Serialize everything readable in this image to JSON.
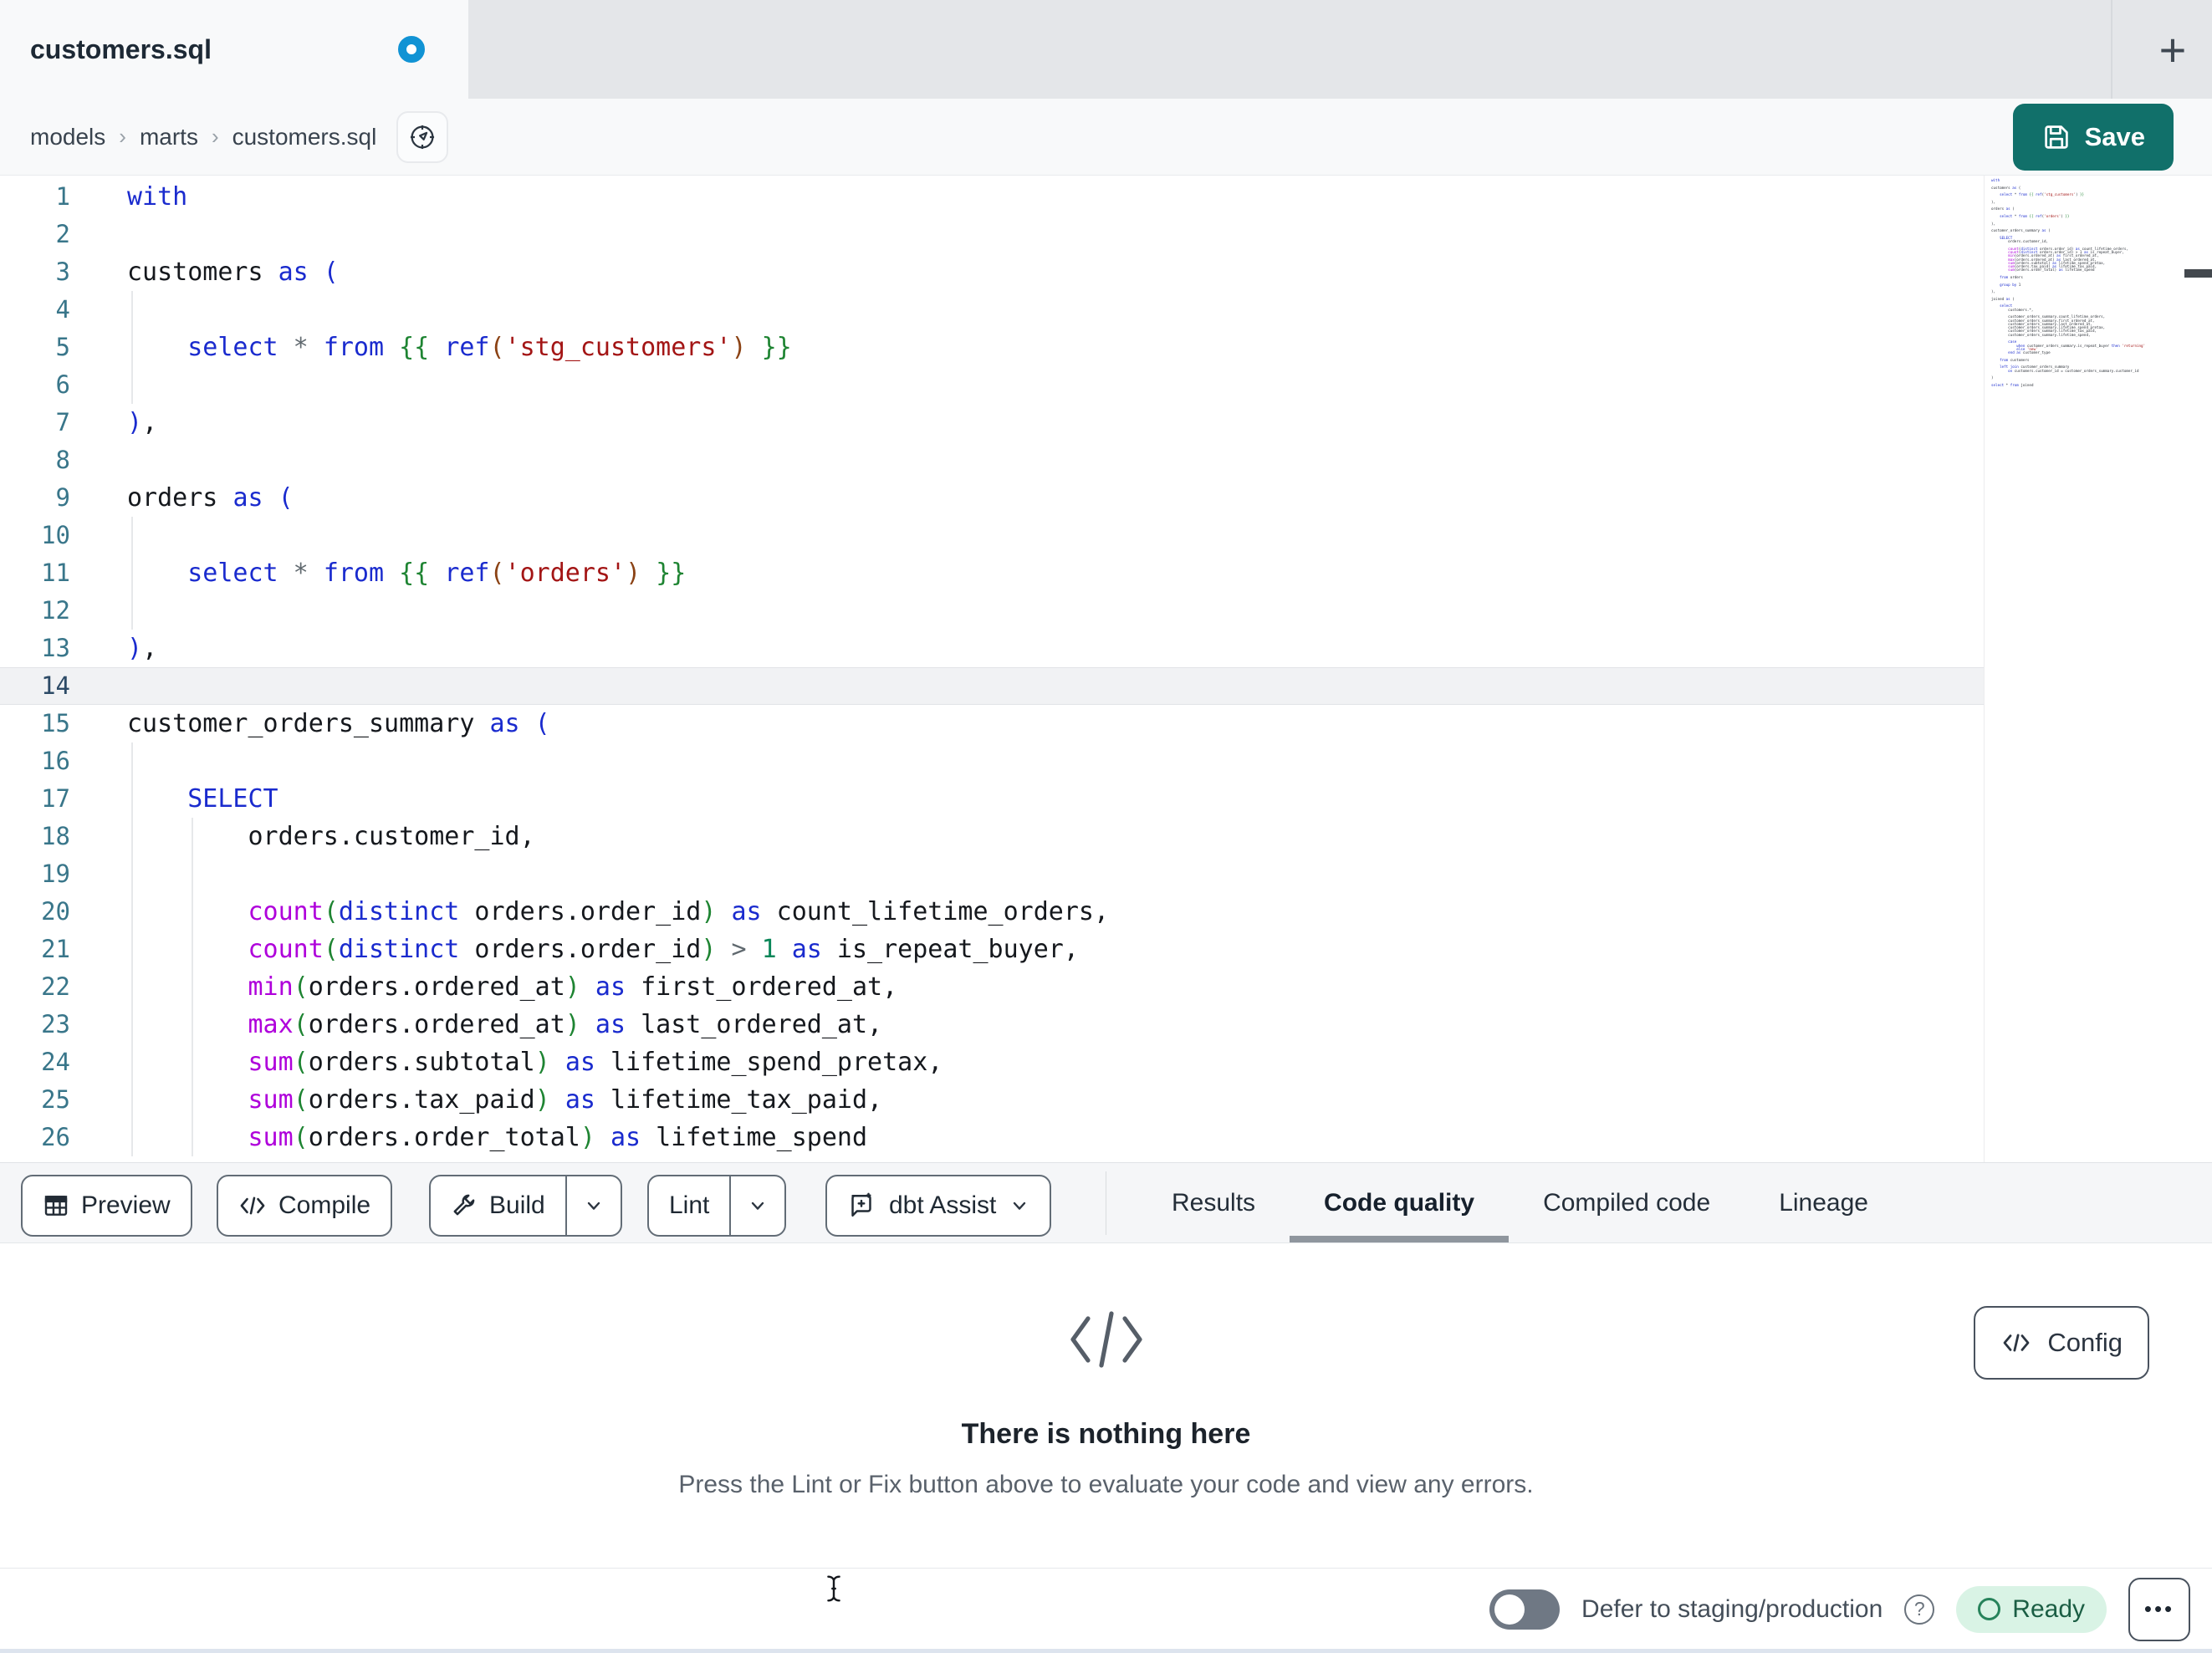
{
  "colors": {
    "accent_teal": "#11706a",
    "unsaved_dot_blue": "#1193d4",
    "ready_bg_green": "#d9f3e5",
    "ready_text_green": "#1b5e44",
    "keyword_blue": "#1a2bce",
    "string_red": "#a31515",
    "function_magenta": "#af00db"
  },
  "tab_strip": {
    "tab_title": "customers.sql",
    "new_tab_label": "+"
  },
  "breadcrumb": {
    "items": [
      "models",
      "marts",
      "customers.sql"
    ],
    "separator": "›"
  },
  "save": {
    "label": "Save"
  },
  "editor": {
    "active_line": 14,
    "lines": [
      {
        "n": 1,
        "g": 0,
        "tk": [
          [
            "k",
            "with"
          ]
        ]
      },
      {
        "n": 2,
        "g": 0,
        "tk": []
      },
      {
        "n": 3,
        "g": 0,
        "tk": [
          [
            "t",
            "customers "
          ],
          [
            "k",
            "as ("
          ]
        ]
      },
      {
        "n": 4,
        "g": 1,
        "tk": []
      },
      {
        "n": 5,
        "g": 1,
        "tk": [
          [
            "t",
            "    "
          ],
          [
            "k",
            "select"
          ],
          [
            "o",
            " * "
          ],
          [
            "k",
            "from"
          ],
          [
            "t",
            " "
          ],
          [
            "g",
            "{{"
          ],
          [
            "t",
            " "
          ],
          [
            "k",
            "ref"
          ],
          [
            "r",
            "("
          ],
          [
            "s",
            "'stg_customers'"
          ],
          [
            "r",
            ")"
          ],
          [
            "t",
            " "
          ],
          [
            "g",
            "}}"
          ]
        ]
      },
      {
        "n": 6,
        "g": 1,
        "tk": []
      },
      {
        "n": 7,
        "g": 0,
        "tk": [
          [
            "k",
            ")"
          ],
          [
            "t",
            ","
          ]
        ]
      },
      {
        "n": 8,
        "g": 0,
        "tk": []
      },
      {
        "n": 9,
        "g": 0,
        "tk": [
          [
            "t",
            "orders "
          ],
          [
            "k",
            "as ("
          ]
        ]
      },
      {
        "n": 10,
        "g": 1,
        "tk": []
      },
      {
        "n": 11,
        "g": 1,
        "tk": [
          [
            "t",
            "    "
          ],
          [
            "k",
            "select"
          ],
          [
            "o",
            " * "
          ],
          [
            "k",
            "from"
          ],
          [
            "t",
            " "
          ],
          [
            "g",
            "{{"
          ],
          [
            "t",
            " "
          ],
          [
            "k",
            "ref"
          ],
          [
            "r",
            "("
          ],
          [
            "s",
            "'orders'"
          ],
          [
            "r",
            ")"
          ],
          [
            "t",
            " "
          ],
          [
            "g",
            "}}"
          ]
        ]
      },
      {
        "n": 12,
        "g": 1,
        "tk": []
      },
      {
        "n": 13,
        "g": 0,
        "tk": [
          [
            "k",
            ")"
          ],
          [
            "t",
            ","
          ]
        ]
      },
      {
        "n": 14,
        "g": 0,
        "tk": []
      },
      {
        "n": 15,
        "g": 0,
        "tk": [
          [
            "t",
            "customer_orders_summary "
          ],
          [
            "k",
            "as ("
          ]
        ]
      },
      {
        "n": 16,
        "g": 1,
        "tk": []
      },
      {
        "n": 17,
        "g": 1,
        "tk": [
          [
            "t",
            "    "
          ],
          [
            "k",
            "SELECT"
          ]
        ]
      },
      {
        "n": 18,
        "g": 2,
        "tk": [
          [
            "t",
            "        orders.customer_id,"
          ]
        ]
      },
      {
        "n": 19,
        "g": 2,
        "tk": []
      },
      {
        "n": 20,
        "g": 2,
        "tk": [
          [
            "t",
            "        "
          ],
          [
            "f",
            "count"
          ],
          [
            "g",
            "("
          ],
          [
            "k",
            "distinct"
          ],
          [
            "t",
            " orders.order_id"
          ],
          [
            "g",
            ")"
          ],
          [
            "t",
            " "
          ],
          [
            "k",
            "as"
          ],
          [
            "t",
            " count_lifetime_orders,"
          ]
        ]
      },
      {
        "n": 21,
        "g": 2,
        "tk": [
          [
            "t",
            "        "
          ],
          [
            "f",
            "count"
          ],
          [
            "g",
            "("
          ],
          [
            "k",
            "distinct"
          ],
          [
            "t",
            " orders.order_id"
          ],
          [
            "g",
            ")"
          ],
          [
            "o",
            " > "
          ],
          [
            "n",
            "1"
          ],
          [
            "t",
            " "
          ],
          [
            "k",
            "as"
          ],
          [
            "t",
            " is_repeat_buyer,"
          ]
        ]
      },
      {
        "n": 22,
        "g": 2,
        "tk": [
          [
            "t",
            "        "
          ],
          [
            "f",
            "min"
          ],
          [
            "g",
            "("
          ],
          [
            "t",
            "orders.ordered_at"
          ],
          [
            "g",
            ")"
          ],
          [
            "t",
            " "
          ],
          [
            "k",
            "as"
          ],
          [
            "t",
            " first_ordered_at,"
          ]
        ]
      },
      {
        "n": 23,
        "g": 2,
        "tk": [
          [
            "t",
            "        "
          ],
          [
            "f",
            "max"
          ],
          [
            "g",
            "("
          ],
          [
            "t",
            "orders.ordered_at"
          ],
          [
            "g",
            ")"
          ],
          [
            "t",
            " "
          ],
          [
            "k",
            "as"
          ],
          [
            "t",
            " last_ordered_at,"
          ]
        ]
      },
      {
        "n": 24,
        "g": 2,
        "tk": [
          [
            "t",
            "        "
          ],
          [
            "f",
            "sum"
          ],
          [
            "g",
            "("
          ],
          [
            "t",
            "orders.subtotal"
          ],
          [
            "g",
            ")"
          ],
          [
            "t",
            " "
          ],
          [
            "k",
            "as"
          ],
          [
            "t",
            " lifetime_spend_pretax,"
          ]
        ]
      },
      {
        "n": 25,
        "g": 2,
        "tk": [
          [
            "t",
            "        "
          ],
          [
            "f",
            "sum"
          ],
          [
            "g",
            "("
          ],
          [
            "t",
            "orders.tax_paid"
          ],
          [
            "g",
            ")"
          ],
          [
            "t",
            " "
          ],
          [
            "k",
            "as"
          ],
          [
            "t",
            " lifetime_tax_paid,"
          ]
        ]
      },
      {
        "n": 26,
        "g": 2,
        "tk": [
          [
            "t",
            "        "
          ],
          [
            "f",
            "sum"
          ],
          [
            "g",
            "("
          ],
          [
            "t",
            "orders.order_total"
          ],
          [
            "g",
            ")"
          ],
          [
            "t",
            " "
          ],
          [
            "k",
            "as"
          ],
          [
            "t",
            " lifetime_spend"
          ]
        ]
      }
    ]
  },
  "minimap": {
    "lines": [
      "with",
      "",
      "customers as (",
      "",
      "    select * from {{ ref('stg_customers') }}",
      "",
      "),",
      "",
      "orders as (",
      "",
      "    select * from {{ ref('orders') }}",
      "",
      "),",
      "",
      "customer_orders_summary as (",
      "",
      "    SELECT",
      "        orders.customer_id,",
      "",
      "        count(distinct orders.order_id) as count_lifetime_orders,",
      "        count(distinct orders.order_id) > 1 as is_repeat_buyer,",
      "        min(orders.ordered_at) as first_ordered_at,",
      "        max(orders.ordered_at) as last_ordered_at,",
      "        sum(orders.subtotal) as lifetime_spend_pretax,",
      "        sum(orders.tax_paid) as lifetime_tax_paid,",
      "        sum(orders.order_total) as lifetime_spend",
      "",
      "    from orders",
      "",
      "    group by 1",
      "",
      "),",
      "",
      "joined as (",
      "",
      "    select",
      "        customers.*,",
      "",
      "        customer_orders_summary.count_lifetime_orders,",
      "        customer_orders_summary.first_ordered_at,",
      "        customer_orders_summary.last_ordered_at,",
      "        customer_orders_summary.lifetime_spend_pretax,",
      "        customer_orders_summary.lifetime_tax_paid,",
      "        customer_orders_summary.lifetime_spend,",
      "",
      "        case",
      "            when customer_orders_summary.is_repeat_buyer then 'returning'",
      "            else 'new'",
      "        end as customer_type",
      "",
      "    from customers",
      "",
      "    left join customer_orders_summary",
      "        on customers.customer_id = customer_orders_summary.customer_id",
      "",
      ")",
      "",
      "select * from joined"
    ]
  },
  "toolbar": {
    "preview_label": "Preview",
    "compile_label": "Compile",
    "build_label": "Build",
    "lint_label": "Lint",
    "assist_label": "dbt Assist"
  },
  "panel_tabs": {
    "items": [
      {
        "label": "Results",
        "active": false
      },
      {
        "label": "Code quality",
        "active": true
      },
      {
        "label": "Compiled code",
        "active": false
      },
      {
        "label": "Lineage",
        "active": false
      }
    ]
  },
  "empty_state": {
    "title": "There is nothing here",
    "subtitle": "Press the Lint or Fix button above to evaluate your code and view any errors.",
    "config_label": "Config"
  },
  "status_bar": {
    "defer_label": "Defer to staging/production",
    "help_glyph": "?",
    "ready_label": "Ready",
    "more_label": "•••"
  }
}
